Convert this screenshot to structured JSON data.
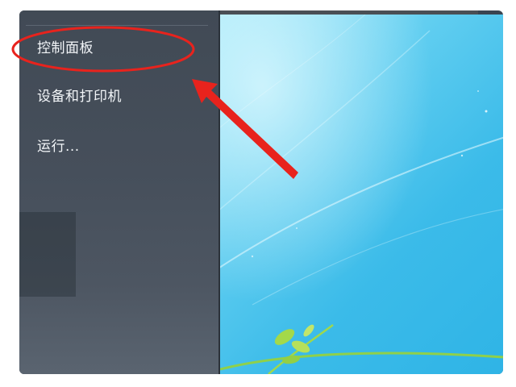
{
  "start_menu": {
    "items": [
      {
        "label": "控制面板"
      },
      {
        "label": "设备和打印机"
      },
      {
        "label": "运行..."
      }
    ]
  },
  "annotation": {
    "color": "#e8231d"
  },
  "desktop": {
    "wallpaper": "windows-7-default-wallpaper"
  }
}
